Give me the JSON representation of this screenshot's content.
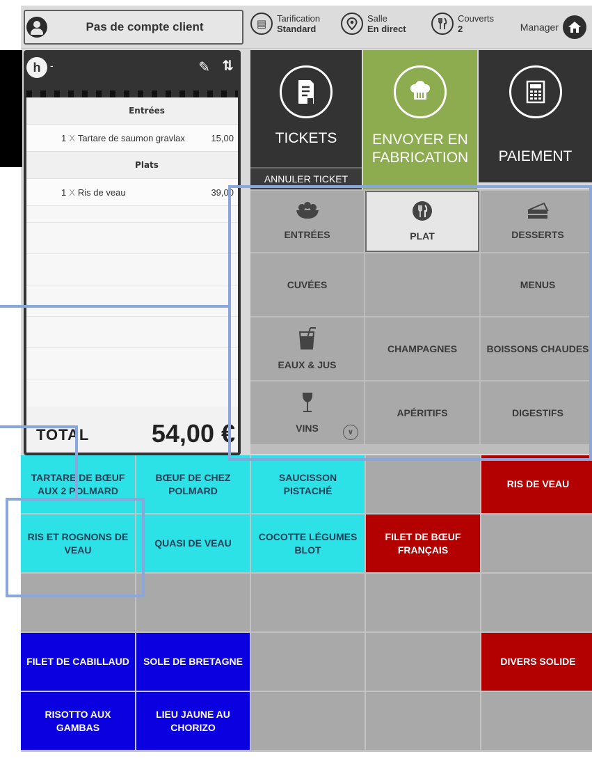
{
  "topbar": {
    "client_label": "Pas de compte client",
    "tarification": {
      "title": "Tarification",
      "value": "Standard"
    },
    "salle": {
      "title": "Salle",
      "value": "En direct"
    },
    "couverts": {
      "title": "Couverts",
      "value": "2"
    },
    "manager_label": "Manager"
  },
  "ticket": {
    "table_label": "-",
    "lines": [
      {
        "type": "category",
        "label": "Entrées"
      },
      {
        "type": "item",
        "qty": "1",
        "x": "X",
        "name": "Tartare de saumon gravlax",
        "price": "15,00"
      },
      {
        "type": "category",
        "label": "Plats"
      },
      {
        "type": "item",
        "qty": "1",
        "x": "X",
        "name": "Ris de veau",
        "price": "39,00"
      }
    ],
    "total_label": "TOTAL",
    "total_value": "54,00 €"
  },
  "actions": {
    "tickets": "TICKETS",
    "envoyer": "ENVOYER EN FABRICATION",
    "paiement": "PAIEMENT",
    "annuler": "ANNULER TICKET"
  },
  "categories": [
    {
      "label": "ENTRÉES",
      "icon": "salad-icon"
    },
    {
      "label": "PLAT",
      "icon": "utensils-icon"
    },
    {
      "label": "DESSERTS",
      "icon": "cake-icon"
    },
    {
      "label": "CUVÉES",
      "icon": ""
    },
    {
      "label": "",
      "icon": ""
    },
    {
      "label": "MENUS",
      "icon": ""
    },
    {
      "label": "EAUX & JUS",
      "icon": "glass-icon"
    },
    {
      "label": "CHAMPAGNES",
      "icon": ""
    },
    {
      "label": "BOISSONS CHAUDES",
      "icon": ""
    },
    {
      "label": "VINS",
      "icon": "wine-icon"
    },
    {
      "label": "APÉRITIFS",
      "icon": ""
    },
    {
      "label": "DIGESTIFS",
      "icon": ""
    }
  ],
  "products": [
    [
      "TARTARE DE BŒUF AUX 2 POLMARD",
      "BŒUF DE CHEZ POLMARD",
      "SAUCISSON PISTACHÉ",
      "",
      "RIS DE VEAU"
    ],
    [
      "RIS ET ROGNONS DE VEAU",
      "QUASI DE VEAU",
      "COCOTTE LÉGUMES BLOT",
      "FILET DE BŒUF FRANÇAIS",
      ""
    ],
    [
      "",
      "",
      "",
      "",
      ""
    ],
    [
      "FILET DE CABILLAUD",
      "SOLE DE BRETAGNE",
      "",
      "",
      "DIVERS SOLIDE"
    ],
    [
      "RISOTTO AUX GAMBAS",
      "LIEU JAUNE AU CHORIZO",
      "",
      "",
      ""
    ]
  ],
  "colors": {
    "cyan": "#2de2e6",
    "red": "#b30000",
    "blue": "#0a00e0",
    "green_action": "#8dab4f",
    "dark_action": "#333333",
    "highlight": "#8aa7dd"
  }
}
